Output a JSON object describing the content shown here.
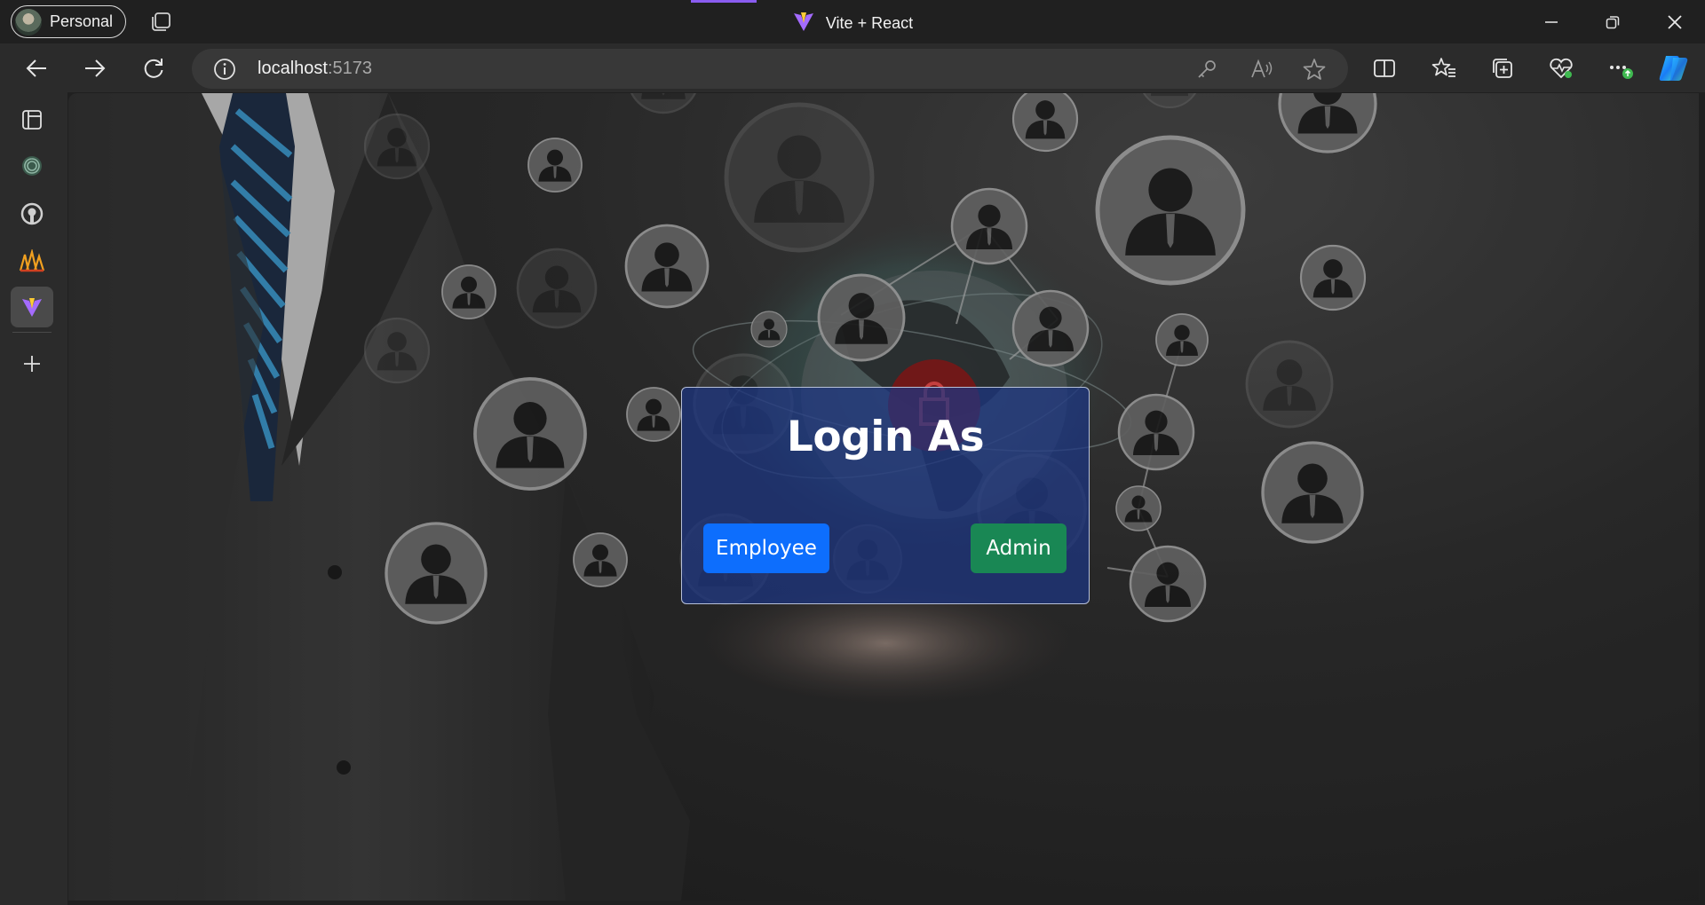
{
  "browser": {
    "profile_label": "Personal",
    "window_title": "Vite + React",
    "address": {
      "host": "localhost",
      "port": ":5173"
    }
  },
  "page": {
    "login": {
      "title": "Login As",
      "employee_label": "Employee",
      "admin_label": "Admin"
    }
  },
  "colors": {
    "employee_button": "#0d6efd",
    "admin_button": "#198754",
    "card": "#1c3482"
  },
  "icons": {
    "sidebar": [
      "sidebar-layout-icon",
      "chatgpt-icon",
      "github-icon",
      "app-icon",
      "vite-icon",
      "add-icon"
    ],
    "toolbar": [
      "back-icon",
      "forward-icon",
      "refresh-icon",
      "split-screen-icon",
      "favorites-icon",
      "collections-icon",
      "health-icon",
      "more-icon",
      "copilot-icon"
    ]
  }
}
